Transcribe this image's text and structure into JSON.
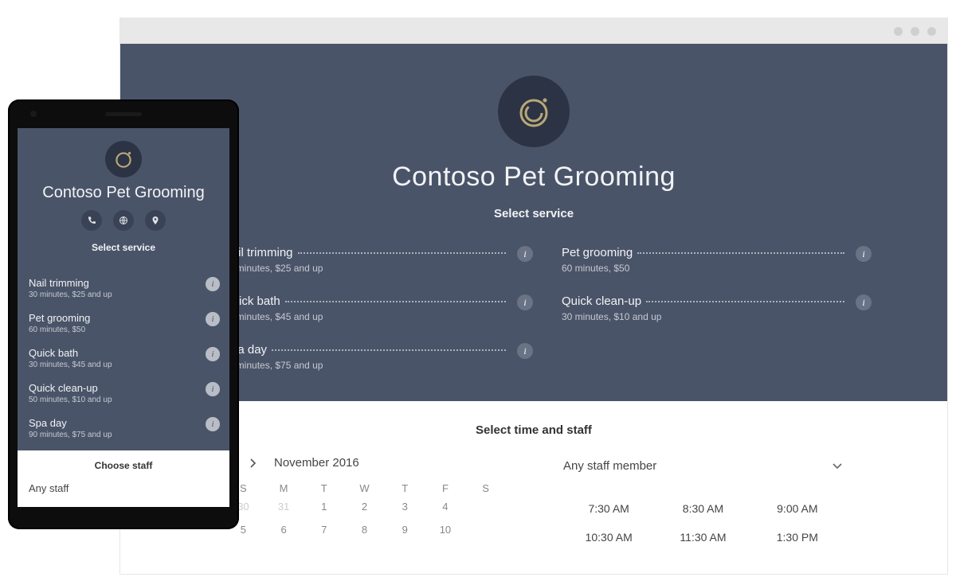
{
  "business": {
    "name": "Contoso Pet Grooming"
  },
  "labels": {
    "select_service": "Select service",
    "select_time_staff": "Select time and staff",
    "choose_staff": "Choose staff"
  },
  "services": [
    {
      "name": "Nail trimming",
      "meta": "30 minutes, $25 and up"
    },
    {
      "name": "Pet grooming",
      "meta": "60 minutes, $50"
    },
    {
      "name": "Quick bath",
      "meta": "30 minutes, $45 and up"
    },
    {
      "name": "Quick clean-up",
      "meta": "30 minutes, $10 and up"
    },
    {
      "name": "Spa day",
      "meta": "90 minutes, $75 and up"
    }
  ],
  "mobile_services": [
    {
      "name": "Nail trimming",
      "meta": "30 minutes, $25 and up"
    },
    {
      "name": "Pet grooming",
      "meta": "60 minutes, $50"
    },
    {
      "name": "Quick bath",
      "meta": "30 minutes, $45 and up"
    },
    {
      "name": "Quick clean-up",
      "meta": "50 minutes, $10 and up"
    },
    {
      "name": "Spa day",
      "meta": "90 minutes, $75 and up"
    }
  ],
  "calendar": {
    "month_label": "November 2016",
    "dow": [
      "S",
      "M",
      "T",
      "W",
      "T",
      "F",
      "S"
    ],
    "row1": [
      "30",
      "31",
      "1",
      "2",
      "3",
      "4",
      ""
    ],
    "row2": [
      "5",
      "6",
      "7",
      "8",
      "9",
      "10",
      ""
    ]
  },
  "staff": {
    "desktop_selected": "Any staff member",
    "mobile_selected": "Any staff"
  },
  "times": {
    "r1": [
      "7:30 AM",
      "8:30 AM",
      "9:00 AM"
    ],
    "r2": [
      "10:30 AM",
      "11:30 AM",
      "1:30 PM"
    ]
  }
}
